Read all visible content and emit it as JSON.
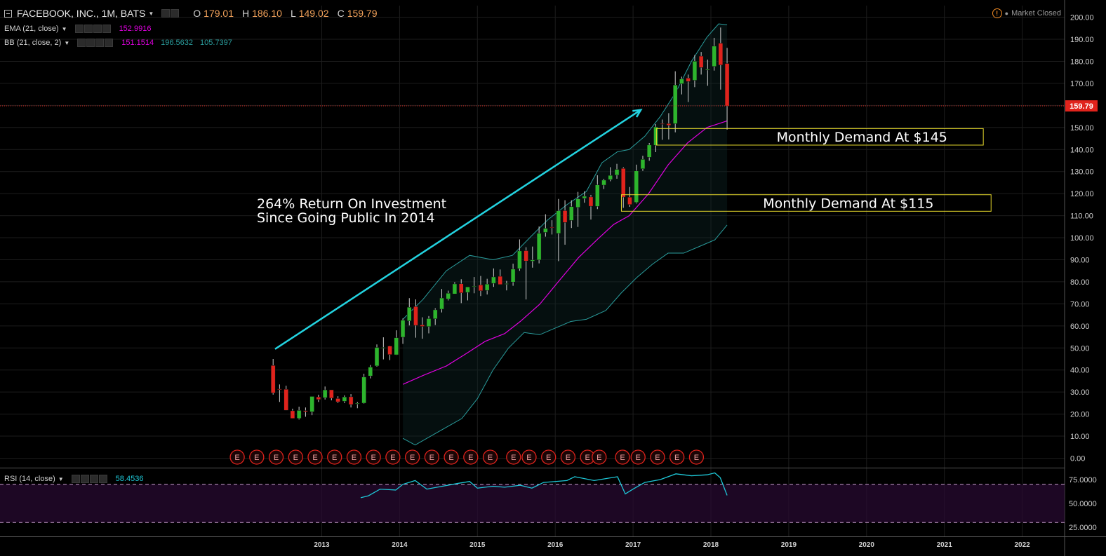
{
  "header": {
    "symbol_title": "FACEBOOK, INC., 1M, BATS",
    "open_label": "O",
    "open_value": "179.01",
    "high_label": "H",
    "high_value": "186.10",
    "low_label": "L",
    "low_value": "149.02",
    "close_label": "C",
    "close_value": "159.79",
    "market_status": "Market Closed"
  },
  "indicators": {
    "ema": {
      "label": "EMA (21, close)",
      "value": "152.9916",
      "color": "#e000e0"
    },
    "bb": {
      "label": "BB (21, close, 2)",
      "basis": "151.1514",
      "upper": "196.5632",
      "lower": "105.7397",
      "basis_color": "#e000e0",
      "band_color": "#2a9d9d"
    },
    "rsi": {
      "label": "RSI (14, close)",
      "value": "58.4536",
      "color": "#1ec8d8"
    }
  },
  "colors": {
    "up": "#2db52d",
    "down": "#e0231c",
    "price_line": "#e0231c",
    "zone": "#e6d92b",
    "arrow": "#23d3e0",
    "earnings": "#e0231c"
  },
  "chart_data": {
    "type": "candlestick",
    "ylim": [
      0,
      200
    ],
    "x_ticks": [
      "2013",
      "2014",
      "2015",
      "2016",
      "2017",
      "2018",
      "2019",
      "2020",
      "2021",
      "2022"
    ],
    "y_ticks": [
      "0.00",
      "10.00",
      "20.00",
      "30.00",
      "40.00",
      "50.00",
      "60.00",
      "70.00",
      "80.00",
      "90.00",
      "100.00",
      "110.00",
      "120.00",
      "130.00",
      "140.00",
      "150.00",
      "160.00",
      "170.00",
      "180.00",
      "190.00",
      "200.00"
    ],
    "last_price_label": "159.79",
    "candles": [
      [
        2012.375,
        42.05,
        45.0,
        28.84,
        29.6
      ],
      [
        2012.458,
        31.36,
        33.45,
        25.52,
        31.1
      ],
      [
        2012.542,
        31.25,
        32.88,
        21.61,
        21.71
      ],
      [
        2012.625,
        21.5,
        22.45,
        18.03,
        18.06
      ],
      [
        2012.708,
        18.08,
        23.37,
        17.55,
        21.66
      ],
      [
        2012.792,
        21.57,
        23.0,
        18.8,
        21.11
      ],
      [
        2012.875,
        21.08,
        28.0,
        19.5,
        28.0
      ],
      [
        2012.958,
        27.75,
        28.8,
        25.5,
        26.62
      ],
      [
        2013.042,
        27.44,
        32.51,
        26.6,
        30.98
      ],
      [
        2013.125,
        31.0,
        31.0,
        26.25,
        27.25
      ],
      [
        2013.208,
        27.05,
        28.1,
        25.0,
        25.58
      ],
      [
        2013.292,
        25.8,
        28.5,
        25.0,
        27.77
      ],
      [
        2013.375,
        27.85,
        29.07,
        23.0,
        24.35
      ],
      [
        2013.458,
        24.65,
        25.5,
        22.65,
        24.88
      ],
      [
        2013.542,
        24.97,
        38.31,
        24.73,
        36.8
      ],
      [
        2013.625,
        37.3,
        42.26,
        36.2,
        41.29
      ],
      [
        2013.708,
        41.85,
        51.6,
        41.5,
        50.23
      ],
      [
        2013.792,
        50.0,
        54.83,
        44.82,
        50.21
      ],
      [
        2013.875,
        50.85,
        50.99,
        44.5,
        47.01
      ],
      [
        2013.958,
        46.9,
        58.0,
        46.8,
        54.65
      ],
      [
        2014.042,
        54.86,
        63.37,
        51.85,
        62.57
      ],
      [
        2014.125,
        62.26,
        72.59,
        60.21,
        68.46
      ],
      [
        2014.208,
        68.77,
        72.03,
        54.66,
        60.24
      ],
      [
        2014.292,
        60.46,
        63.91,
        54.19,
        59.78
      ],
      [
        2014.375,
        59.7,
        64.46,
        56.62,
        63.3
      ],
      [
        2014.458,
        63.23,
        68.0,
        60.39,
        67.29
      ],
      [
        2014.542,
        67.58,
        76.74,
        66.11,
        72.65
      ],
      [
        2014.625,
        72.22,
        75.99,
        71.55,
        74.82
      ],
      [
        2014.708,
        74.5,
        79.85,
        74.5,
        79.04
      ],
      [
        2014.792,
        79.1,
        81.16,
        70.32,
        74.99
      ],
      [
        2014.875,
        75.2,
        77.51,
        71.57,
        77.7
      ],
      [
        2014.958,
        77.7,
        82.17,
        74.8,
        78.02
      ],
      [
        2015.042,
        78.58,
        82.65,
        73.54,
        75.91
      ],
      [
        2015.125,
        76.11,
        81.37,
        74.25,
        78.97
      ],
      [
        2015.208,
        79.3,
        86.07,
        77.7,
        82.22
      ],
      [
        2015.292,
        82.5,
        85.59,
        79.76,
        78.77
      ],
      [
        2015.375,
        79.0,
        80.42,
        76.11,
        79.19
      ],
      [
        2015.458,
        79.9,
        88.23,
        78.2,
        85.77
      ],
      [
        2015.542,
        86.0,
        99.24,
        85.0,
        94.01
      ],
      [
        2015.625,
        94.12,
        95.7,
        72.0,
        89.43
      ],
      [
        2015.708,
        89.36,
        95.99,
        86.42,
        89.9
      ],
      [
        2015.792,
        89.9,
        105.12,
        88.36,
        101.97
      ],
      [
        2015.875,
        102.4,
        110.65,
        100.47,
        104.24
      ],
      [
        2015.958,
        104.83,
        107.92,
        101.46,
        104.66
      ],
      [
        2016.042,
        101.95,
        117.59,
        89.37,
        112.21
      ],
      [
        2016.125,
        112.27,
        117.0,
        96.82,
        106.92
      ],
      [
        2016.208,
        107.83,
        116.99,
        104.4,
        114.1
      ],
      [
        2016.292,
        113.75,
        120.79,
        104.88,
        117.58
      ],
      [
        2016.375,
        117.83,
        121.08,
        115.88,
        118.81
      ],
      [
        2016.458,
        118.5,
        119.44,
        108.23,
        114.28
      ],
      [
        2016.542,
        114.2,
        128.33,
        112.97,
        123.94
      ],
      [
        2016.625,
        123.85,
        126.73,
        122.07,
        126.12
      ],
      [
        2016.708,
        126.38,
        131.98,
        125.6,
        128.27
      ],
      [
        2016.792,
        128.38,
        133.5,
        126.75,
        130.99
      ],
      [
        2016.875,
        131.41,
        131.94,
        113.55,
        118.42
      ],
      [
        2016.958,
        118.38,
        123.0,
        114.0,
        115.05
      ],
      [
        2017.042,
        116.03,
        133.14,
        115.51,
        130.32
      ],
      [
        2017.125,
        131.25,
        137.18,
        130.3,
        135.54
      ],
      [
        2017.208,
        136.47,
        142.95,
        134.92,
        142.05
      ],
      [
        2017.292,
        141.93,
        151.53,
        138.81,
        150.25
      ],
      [
        2017.375,
        151.74,
        153.6,
        144.42,
        151.46
      ],
      [
        2017.458,
        151.75,
        156.5,
        144.56,
        150.98
      ],
      [
        2017.542,
        151.72,
        175.49,
        147.8,
        169.25
      ],
      [
        2017.625,
        169.82,
        173.05,
        165.0,
        171.97
      ],
      [
        2017.708,
        172.4,
        174.0,
        161.56,
        170.87
      ],
      [
        2017.792,
        171.39,
        182.9,
        168.29,
        180.06
      ],
      [
        2017.875,
        182.36,
        184.25,
        174.0,
        177.18
      ],
      [
        2017.958,
        176.03,
        180.8,
        168.91,
        176.46
      ],
      [
        2018.042,
        177.68,
        190.66,
        175.8,
        186.89
      ],
      [
        2018.125,
        188.22,
        195.32,
        167.18,
        178.32
      ],
      [
        2018.208,
        179.01,
        186.1,
        149.02,
        159.79
      ]
    ],
    "ema": [
      [
        2014.042,
        33.5
      ],
      [
        2014.3,
        37.5
      ],
      [
        2014.6,
        41.8
      ],
      [
        2014.85,
        47.3
      ],
      [
        2015.1,
        53.0
      ],
      [
        2015.35,
        56.5
      ],
      [
        2015.55,
        62.0
      ],
      [
        2015.8,
        69.8
      ],
      [
        2016.05,
        80.5
      ],
      [
        2016.3,
        91.0
      ],
      [
        2016.55,
        99.5
      ],
      [
        2016.75,
        106.0
      ],
      [
        2016.95,
        110.0
      ],
      [
        2017.2,
        120.0
      ],
      [
        2017.45,
        133.0
      ],
      [
        2017.7,
        143.0
      ],
      [
        2017.95,
        150.0
      ],
      [
        2018.208,
        152.99
      ]
    ],
    "bb_upper": [
      [
        2014.042,
        63
      ],
      [
        2014.3,
        72
      ],
      [
        2014.6,
        85
      ],
      [
        2014.9,
        92
      ],
      [
        2015.2,
        90
      ],
      [
        2015.45,
        92
      ],
      [
        2015.7,
        101
      ],
      [
        2015.9,
        108
      ],
      [
        2016.15,
        115
      ],
      [
        2016.4,
        121
      ],
      [
        2016.6,
        134
      ],
      [
        2016.8,
        139
      ],
      [
        2016.95,
        140
      ],
      [
        2017.15,
        146
      ],
      [
        2017.35,
        155
      ],
      [
        2017.55,
        166
      ],
      [
        2017.75,
        180
      ],
      [
        2017.95,
        191
      ],
      [
        2018.1,
        197
      ],
      [
        2018.208,
        196.56
      ]
    ],
    "bb_lower": [
      [
        2014.042,
        9
      ],
      [
        2014.2,
        6
      ],
      [
        2014.4,
        10
      ],
      [
        2014.6,
        14
      ],
      [
        2014.8,
        18
      ],
      [
        2015.0,
        27
      ],
      [
        2015.2,
        40
      ],
      [
        2015.4,
        50
      ],
      [
        2015.6,
        57
      ],
      [
        2015.8,
        56
      ],
      [
        2016.0,
        59
      ],
      [
        2016.2,
        62
      ],
      [
        2016.4,
        63
      ],
      [
        2016.65,
        67
      ],
      [
        2016.85,
        75
      ],
      [
        2017.05,
        82
      ],
      [
        2017.25,
        88
      ],
      [
        2017.45,
        93
      ],
      [
        2017.65,
        93
      ],
      [
        2017.85,
        96
      ],
      [
        2018.05,
        99
      ],
      [
        2018.208,
        105.74
      ]
    ],
    "rsi": [
      [
        2013.5,
        56
      ],
      [
        2013.6,
        58
      ],
      [
        2013.75,
        65
      ],
      [
        2013.95,
        64
      ],
      [
        2014.042,
        70
      ],
      [
        2014.2,
        74
      ],
      [
        2014.35,
        65
      ],
      [
        2014.55,
        68
      ],
      [
        2014.75,
        71
      ],
      [
        2014.9,
        73
      ],
      [
        2015.0,
        66
      ],
      [
        2015.2,
        68
      ],
      [
        2015.35,
        67
      ],
      [
        2015.55,
        69
      ],
      [
        2015.7,
        66
      ],
      [
        2015.85,
        72
      ],
      [
        2016.0,
        73
      ],
      [
        2016.15,
        74
      ],
      [
        2016.25,
        78
      ],
      [
        2016.5,
        74
      ],
      [
        2016.65,
        76
      ],
      [
        2016.8,
        78
      ],
      [
        2016.9,
        60
      ],
      [
        2017.0,
        65
      ],
      [
        2017.15,
        72
      ],
      [
        2017.35,
        75
      ],
      [
        2017.55,
        81
      ],
      [
        2017.75,
        79
      ],
      [
        2017.95,
        80
      ],
      [
        2018.05,
        82
      ],
      [
        2018.12,
        77
      ],
      [
        2018.208,
        58.45
      ]
    ],
    "rsi_levels": [
      70,
      30
    ],
    "earnings_dates": [
      2012.55,
      2012.8,
      2013.05,
      2013.3,
      2013.55,
      2013.8,
      2014.05,
      2014.3,
      2014.55,
      2014.8,
      2015.05,
      2015.3,
      2015.55,
      2015.8,
      2016.1,
      2016.3,
      2016.55,
      2016.8,
      2017.05,
      2017.2,
      2017.5,
      2017.7,
      2017.95,
      2018.2,
      2018.45
    ],
    "earnings_label": "E",
    "zones": [
      {
        "label": "Monthly Demand At $145",
        "low": 142,
        "high": 149.5,
        "from": 2017.3,
        "to": 2021.5
      },
      {
        "label": "Monthly Demand At $115",
        "low": 112,
        "high": 119.5,
        "from": 2016.85,
        "to": 2021.6
      }
    ],
    "annotation": {
      "lines": [
        "264% Return On Investment",
        "Since Going Public In 2014"
      ]
    },
    "arrow": {
      "from": [
        2012.4,
        49.5
      ],
      "to": [
        2017.1,
        158
      ]
    },
    "rsi_ticks": [
      "75.0000",
      "50.0000",
      "25.0000"
    ],
    "rsi_ylim": [
      20,
      80
    ]
  }
}
